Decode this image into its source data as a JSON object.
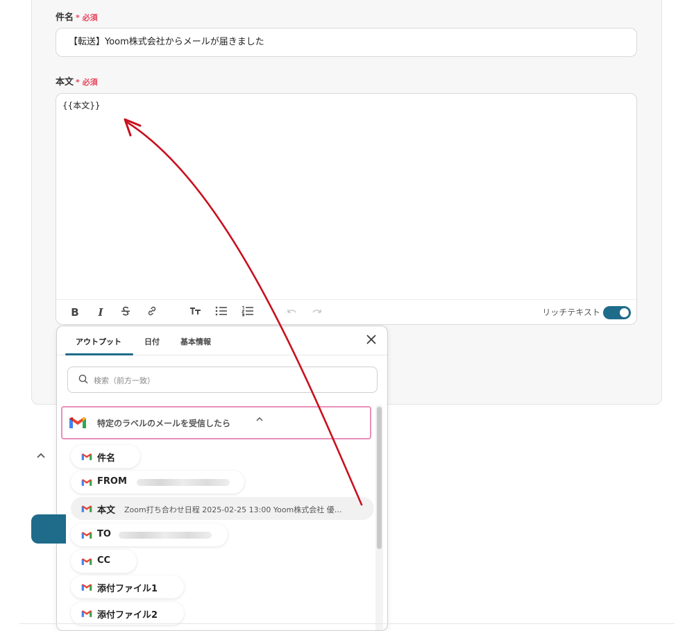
{
  "subject": {
    "label": "件名",
    "required": "* 必須",
    "value": "【転送】Yoom株式会社からメールが届きました"
  },
  "body": {
    "label": "本文",
    "required": "* 必須",
    "value": "{{本文}}"
  },
  "toolbar": {
    "bold": "B",
    "italic": "I",
    "strike": "S",
    "rich_text_label": "リッチテキスト",
    "rich_text_on": true
  },
  "popup": {
    "tabs": [
      "アウトプット",
      "日付",
      "基本情報"
    ],
    "active_tab": "アウトプット",
    "search_placeholder": "検索（前方一致）",
    "trigger_label": "特定のラベルのメールを受信したら",
    "items": [
      {
        "label": "件名",
        "value": ""
      },
      {
        "label": "FROM",
        "value": ""
      },
      {
        "label": "本文",
        "value": "Zoom打ち合わせ日程 2025-02-25 13:00 Yoom株式会社 優…"
      },
      {
        "label": "TO",
        "value": ""
      },
      {
        "label": "CC",
        "value": ""
      },
      {
        "label": "添付ファイル1",
        "value": ""
      },
      {
        "label": "添付ファイル2",
        "value": ""
      }
    ]
  },
  "colors": {
    "accent": "#1e6b8a",
    "required": "#e8455d",
    "arrow": "#c8101e",
    "trigger_border": "#e88fb9"
  }
}
